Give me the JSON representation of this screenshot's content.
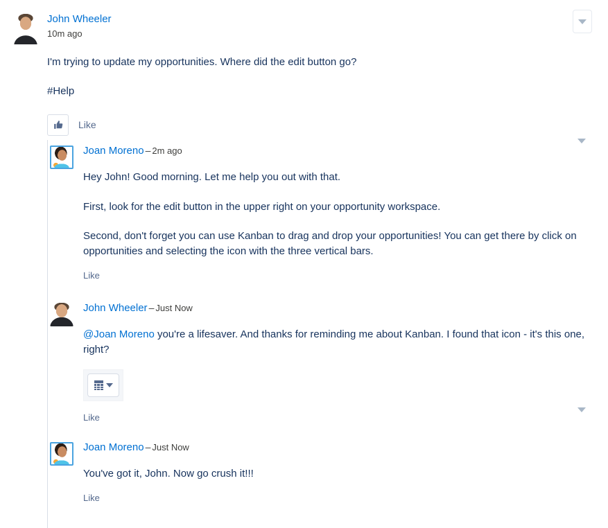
{
  "colors": {
    "link": "#0070d2",
    "text": "#16325c",
    "meta": "#3e3e3c",
    "muted": "#54698d",
    "border": "#d8dde6",
    "caret": "#a8b7c7"
  },
  "post": {
    "author": "John Wheeler",
    "avatar_name": "john-wheeler-avatar",
    "timestamp": "10m ago",
    "paragraphs": [
      "I'm trying to update my opportunities. Where did the edit button go?",
      "#Help"
    ],
    "like_label": "Like",
    "menu_icon": "chevron-down-icon"
  },
  "comments": [
    {
      "author": "Joan Moreno",
      "avatar_name": "joan-moreno-avatar",
      "separator": "–",
      "timestamp": "2m ago",
      "paragraphs": [
        "Hey John! Good morning. Let me help you out with that.",
        "First, look for the edit button in the upper right on your opportunity workspace.",
        "Second, don't forget you can use Kanban to drag and drop your opportunities! You can get there by click on opportunities and selecting the icon with the three vertical bars."
      ],
      "like_label": "Like",
      "has_menu": true,
      "menu_icon": "chevron-down-icon"
    },
    {
      "author": "John Wheeler",
      "avatar_name": "john-wheeler-avatar",
      "separator": "–",
      "timestamp": "Just Now",
      "mention": "@Joan Moreno",
      "paragraph_after_mention": " you're a lifesaver. And thanks for reminding me about Kanban. I found that icon - it's this one, right?",
      "attachment": {
        "name": "kanban-view-switcher-screenshot",
        "icon": "grid-table-icon",
        "caret_icon": "caret-down-icon"
      },
      "like_label": "Like",
      "has_menu": false
    },
    {
      "author": "Joan Moreno",
      "avatar_name": "joan-moreno-avatar",
      "separator": "–",
      "timestamp": "Just Now",
      "paragraphs": [
        "You've got it, John. Now go crush it!!!"
      ],
      "like_label": "Like",
      "has_menu": true,
      "menu_icon": "chevron-down-icon"
    }
  ]
}
